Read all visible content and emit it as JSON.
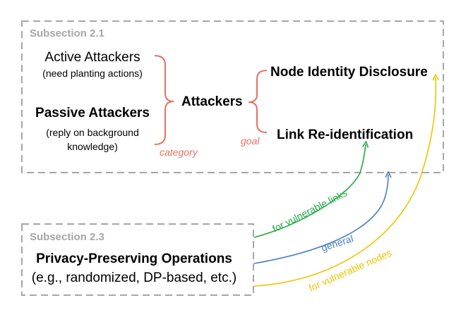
{
  "colors": {
    "box_border": "#a6a6a6",
    "section_title": "#a6a6a6",
    "bracket": "#e8705e",
    "green": "#22aa44",
    "blue": "#4a7fc0",
    "yellow": "#f2c200"
  },
  "section1": {
    "title": "Subsection 2.1",
    "active_attackers": "Active Attackers",
    "active_note": "(need planting actions)",
    "passive_attackers": "Passive Attackers",
    "passive_note_line1": "(reply on background",
    "passive_note_line2": "knowledge)",
    "category_label": "category",
    "attackers": "Attackers",
    "goal_label": "goal",
    "node_identity": "Node Identity Disclosure",
    "link_reid": "Link Re-identification"
  },
  "section2": {
    "title": "Subsection 2.3",
    "operations": "Privacy-Preserving Operations",
    "operations_note": "(e.g., randomized, DP-based, etc.)"
  },
  "edges": {
    "vulnerable_links": "for vulnerable links",
    "general": "general",
    "vulnerable_nodes": "for vulnerable nodes"
  }
}
